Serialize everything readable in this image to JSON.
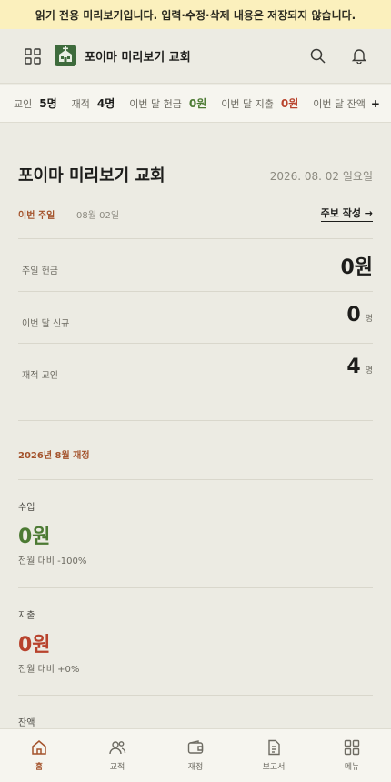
{
  "banner": {
    "text": "읽기 전용 미리보기입니다. 입력·수정·삭제 내용은 저장되지 않습니다."
  },
  "header": {
    "church_name": "포이마 미리보기 교회",
    "icons": [
      "apps-icon",
      "church-logo",
      "search-icon",
      "bell-icon"
    ]
  },
  "stats": {
    "items": [
      {
        "label": "교인",
        "value": "5명",
        "color": "default"
      },
      {
        "label": "재적",
        "value": "4명",
        "color": "default"
      },
      {
        "label": "이번 달 헌금",
        "value": "0원",
        "color": "green"
      },
      {
        "label": "이번 달 지출",
        "value": "0원",
        "color": "red"
      },
      {
        "label": "이번 달 잔액",
        "value": "+",
        "color": "default"
      }
    ]
  },
  "main": {
    "title": "포이마 미리보기 교회",
    "date": "2026. 08. 02 일요일",
    "week_label": "이번 주일",
    "week_date": "08월 02일",
    "bulletin_link": "주보 작성 →",
    "rows": [
      {
        "label": "주일 헌금",
        "value": "0원",
        "unit": ""
      },
      {
        "label": "이번 달 신규",
        "value": "0",
        "unit": "명"
      },
      {
        "label": "재적 교인",
        "value": "4",
        "unit": "명"
      }
    ],
    "finance": {
      "heading": "2026년 8월 재정",
      "income": {
        "label": "수입",
        "amount": "0원",
        "compare": "전월 대비 -100%"
      },
      "expense": {
        "label": "지출",
        "amount": "0원",
        "compare": "전월 대비 +0%"
      },
      "balance": {
        "label": "잔액"
      }
    }
  },
  "nav": {
    "items": [
      {
        "label": "홈",
        "icon": "home-icon",
        "active": true
      },
      {
        "label": "교적",
        "icon": "members-icon",
        "active": false
      },
      {
        "label": "재정",
        "icon": "wallet-icon",
        "active": false
      },
      {
        "label": "보고서",
        "icon": "report-icon",
        "active": false
      },
      {
        "label": "메뉴",
        "icon": "menu-grid-icon",
        "active": false
      }
    ]
  },
  "colors": {
    "accent": "#a4532c",
    "green": "#4c7a33",
    "red": "#b8432d",
    "banner": "#fbf0bd",
    "background": "#ecebe3"
  }
}
